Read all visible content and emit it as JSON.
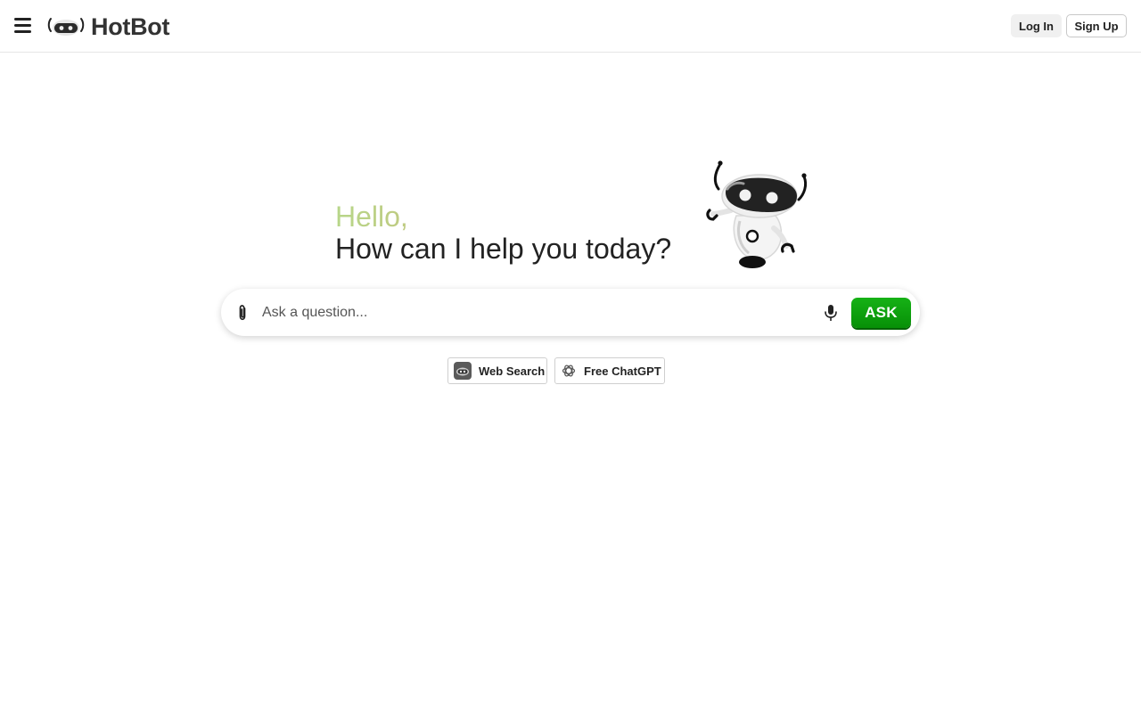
{
  "header": {
    "logo_text": "HotBot",
    "login_label": "Log In",
    "signup_label": "Sign Up",
    "icons": {
      "menu": "hamburger-menu-icon",
      "logo": "robot-head-icon"
    }
  },
  "hero": {
    "greeting": "Hello,",
    "headline": "How can I help you today?"
  },
  "search": {
    "placeholder": "Ask a question...",
    "value": "",
    "ask_label": "ASK",
    "icons": {
      "attach": "paperclip-icon",
      "voice": "microphone-icon"
    },
    "accent_color": "#0a9c0a"
  },
  "chips": [
    {
      "label": "Web Search",
      "icon": "robot-search-icon"
    },
    {
      "label": "Free ChatGPT",
      "icon": "openai-logo-icon"
    }
  ]
}
